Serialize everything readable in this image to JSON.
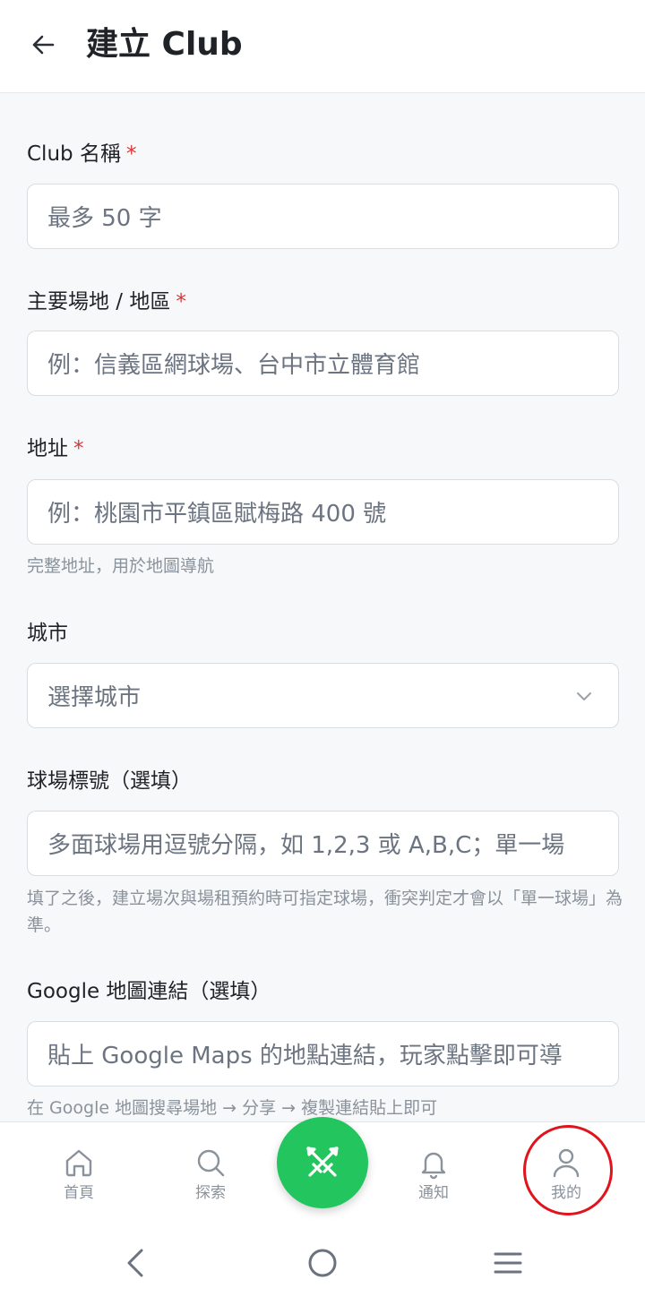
{
  "header": {
    "title": "建立 Club",
    "back_icon": "arrow-left-icon"
  },
  "form": {
    "club_name": {
      "label": "Club 名稱",
      "required_mark": "*",
      "placeholder": "最多 50 字"
    },
    "venue": {
      "label": "主要場地 / 地區",
      "required_mark": "*",
      "placeholder": "例：信義區網球場、台中市立體育館"
    },
    "address": {
      "label": "地址",
      "required_mark": "*",
      "placeholder": "例：桃園市平鎮區賦梅路 400 號",
      "hint": "完整地址，用於地圖導航"
    },
    "city": {
      "label": "城市",
      "placeholder": "選擇城市",
      "chevron_icon": "chevron-down-icon"
    },
    "court_numbers": {
      "label": "球場標號（選填）",
      "placeholder": "多面球場用逗號分隔，如 1,2,3 或 A,B,C；單一場",
      "hint": "填了之後，建立場次與場租預約時可指定球場，衝突判定才會以「單一球場」為準。"
    },
    "map_link": {
      "label": "Google 地圖連結（選填）",
      "placeholder": "貼上 Google Maps 的地點連結，玩家點擊即可導",
      "hint": "在 Google 地圖搜尋場地 → 分享 → 複製連結貼上即可"
    }
  },
  "bottom_nav": {
    "items": [
      {
        "label": "首頁",
        "icon": "home-icon"
      },
      {
        "label": "探索",
        "icon": "search-icon"
      },
      {
        "label": "通知",
        "icon": "bell-icon"
      },
      {
        "label": "我的",
        "icon": "user-icon"
      }
    ],
    "fab_icon": "crossed-swords-icon",
    "fab_color": "#23c55e",
    "highlight_color": "#e0141c"
  },
  "system_nav": {
    "icons": [
      "back-chevron-icon",
      "home-circle-icon",
      "menu-lines-icon"
    ]
  }
}
